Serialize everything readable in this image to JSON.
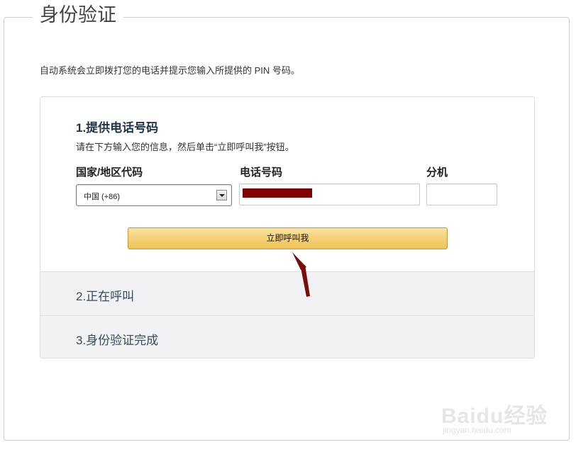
{
  "fieldset": {
    "legend": "身份验证"
  },
  "intro": "自动系统会立即拨打您的电话并提示您输入所提供的 PIN 号码。",
  "step1": {
    "title": "1.提供电话号码",
    "description": "请在下方输入您的信息，然后单击“立即呼叫我”按钮。",
    "country_label": "国家/地区代码",
    "country_value": "中国 (+86)",
    "phone_label": "电话号码",
    "extension_label": "分机",
    "call_button": "立即呼叫我"
  },
  "step2": {
    "title": "2.正在呼叫"
  },
  "step3": {
    "title": "3.身份验证完成"
  },
  "annotation": {
    "arrow_color": "#7a0c0c",
    "redaction_color": "#7f0000"
  },
  "watermark": {
    "brand": "Baidu经验",
    "url": "jingyan.baidu.com"
  }
}
